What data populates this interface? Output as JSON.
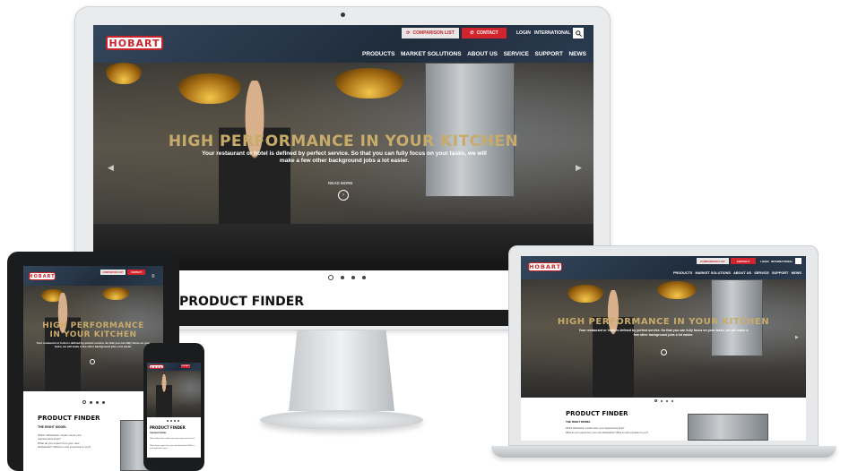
{
  "brand": {
    "logo_text": "HOBART",
    "accent": "#d1242d",
    "gold": "#c7ab6a"
  },
  "topbar": {
    "comparison_label": "COMPARISON LIST",
    "contact_label": "CONTACT",
    "login_label": "LOGIN",
    "international_label": "INTERNATIONAL",
    "search_icon": "search-icon"
  },
  "nav": {
    "items": [
      "PRODUCTS",
      "MARKET SOLUTIONS",
      "ABOUT US",
      "SERVICE",
      "SUPPORT",
      "NEWS"
    ]
  },
  "hero": {
    "title": "HIGH PERFORMANCE IN YOUR KITCHEN",
    "tablet_title": "HIGH PERFORMANCE IN YOUR KITCHEN",
    "subtitle": "Your restaurant or hotel is defined by perfect service. So that you can fully focus on your tasks, we will make a few other background jobs a lot easier.",
    "read_more": "READ MORE",
    "slides": 4,
    "active_slide": 1
  },
  "product_finder": {
    "title": "PRODUCT FINDER",
    "kicker": "THE RIGHT MODEL",
    "line1": "Which dishwasher model meets your requirements best?",
    "line2": "What do you expect from your new dishwasher? What is most important to you?"
  }
}
